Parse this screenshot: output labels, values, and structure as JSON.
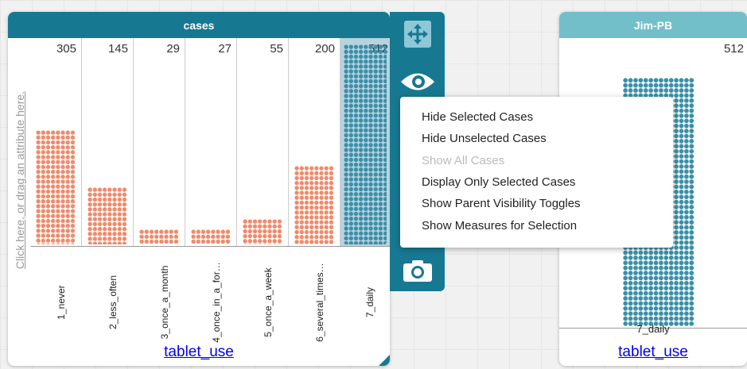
{
  "left_graph": {
    "title": "cases",
    "y_placeholder": "Click here, or drag an attribute here.",
    "x_attribute": "tablet_use",
    "categories": [
      {
        "name": "1_never",
        "count": "305"
      },
      {
        "name": "2_less_often",
        "count": "145"
      },
      {
        "name": "3_once_a_month",
        "count": "29"
      },
      {
        "name": "4_once_in_a_for…",
        "count": "27"
      },
      {
        "name": "5_once_a_week",
        "count": "55"
      },
      {
        "name": "6_several_times…",
        "count": "200"
      },
      {
        "name": "7_daily",
        "count": "512"
      }
    ]
  },
  "right_graph": {
    "title": "Jim-PB",
    "count": "512",
    "category": "7_daily",
    "x_attribute": "tablet_use"
  },
  "toolbar": {
    "tools": [
      "move-icon",
      "eye-icon",
      "camera-icon"
    ]
  },
  "menu": {
    "items": [
      {
        "label": "Hide Selected Cases",
        "enabled": true
      },
      {
        "label": "Hide Unselected Cases",
        "enabled": true
      },
      {
        "label": "Show All Cases",
        "enabled": false
      },
      {
        "label": "Display Only Selected Cases",
        "enabled": true
      },
      {
        "label": "Show Parent Visibility Toggles",
        "enabled": true
      },
      {
        "label": "Show Measures for Selection",
        "enabled": true
      }
    ]
  },
  "colors": {
    "title_bar": "#177991",
    "title_bar_inactive": "#72bfca",
    "unselected_point": "#ef8a6a",
    "selected_point": "#3a8fa8"
  }
}
